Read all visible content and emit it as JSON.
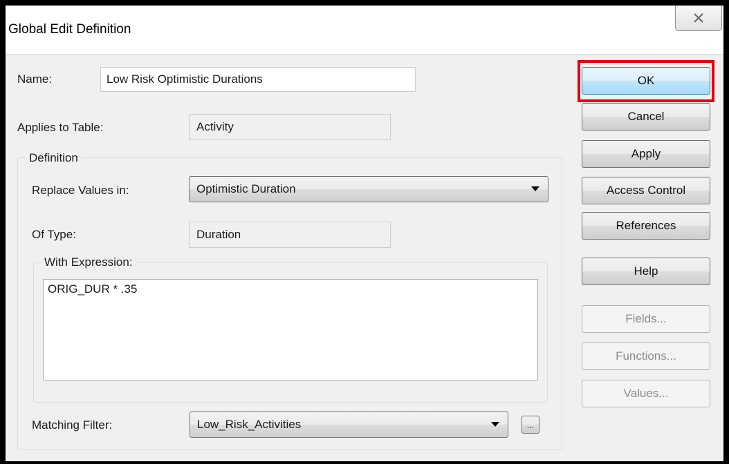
{
  "window": {
    "title": "Global Edit Definition"
  },
  "form": {
    "name_label": "Name:",
    "name_value": "Low Risk Optimistic Durations",
    "applies_label": "Applies to Table:",
    "applies_value": "Activity",
    "definition_group": "Definition",
    "replace_label": "Replace Values in:",
    "replace_value": "Optimistic Duration",
    "type_label": "Of Type:",
    "type_value": "Duration",
    "expression_group": "With Expression:",
    "expression_value": "ORIG_DUR * .35",
    "filter_label": "Matching Filter:",
    "filter_value": "Low_Risk_Activities",
    "filter_button": "..."
  },
  "buttons": {
    "ok": "OK",
    "cancel": "Cancel",
    "apply": "Apply",
    "access_control": "Access Control",
    "references": "References",
    "help": "Help",
    "fields": "Fields...",
    "functions": "Functions...",
    "values": "Values..."
  },
  "colors": {
    "highlight": "#e3000f",
    "default_button": "#bee6fd"
  },
  "icons": {
    "close": "close-x-icon",
    "dropdown": "chevron-down-icon"
  }
}
